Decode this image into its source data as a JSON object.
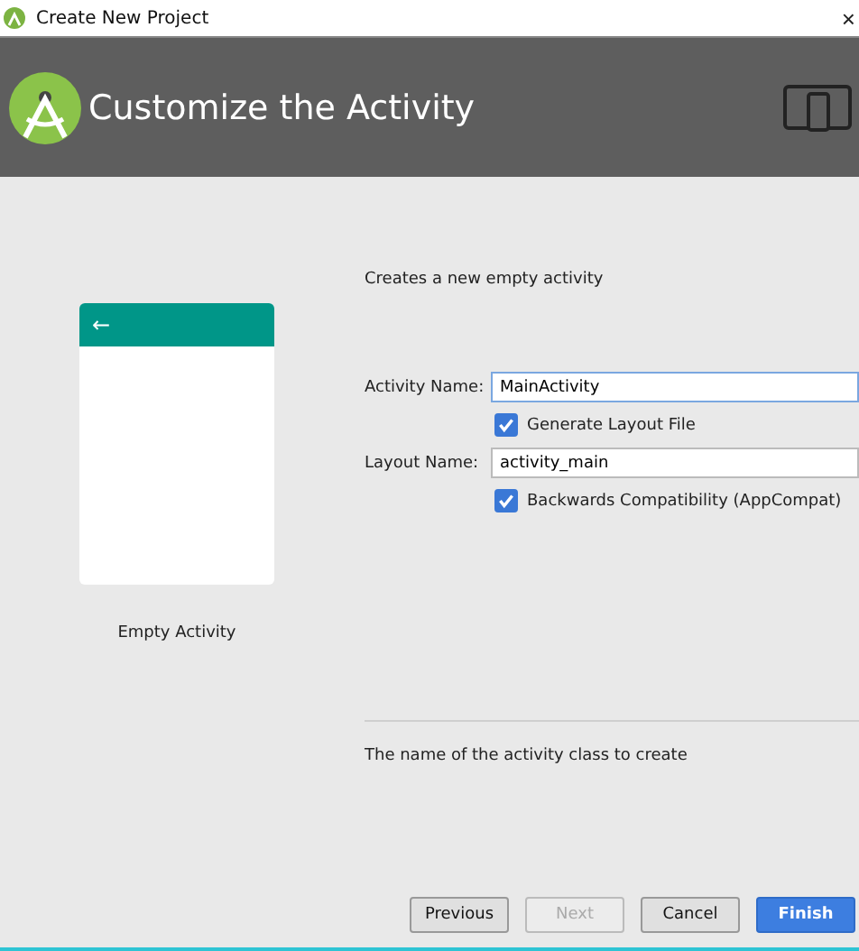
{
  "window": {
    "title": "Create New Project",
    "close": "×"
  },
  "header": {
    "title": "Customize the Activity"
  },
  "preview": {
    "back": "←",
    "label": "Empty Activity"
  },
  "description": "Creates a new empty activity",
  "fields": [
    {
      "kind": "text",
      "label": "Activity Name:",
      "value": "MainActivity",
      "selected": true
    },
    {
      "kind": "check",
      "label": "Generate Layout File",
      "checked": true
    },
    {
      "kind": "text",
      "label": "Layout Name:",
      "value": "activity_main",
      "selected": false
    },
    {
      "kind": "check",
      "label": "Backwards Compatibility (AppCompat)",
      "checked": true
    }
  ],
  "hint": "The name of the activity class to create",
  "buttons": [
    {
      "label": "Previous",
      "disabled": false,
      "primary": false
    },
    {
      "label": "Next",
      "disabled": true,
      "primary": false
    },
    {
      "label": "Cancel",
      "disabled": false,
      "primary": false
    },
    {
      "label": "Finish",
      "disabled": false,
      "primary": true
    }
  ]
}
